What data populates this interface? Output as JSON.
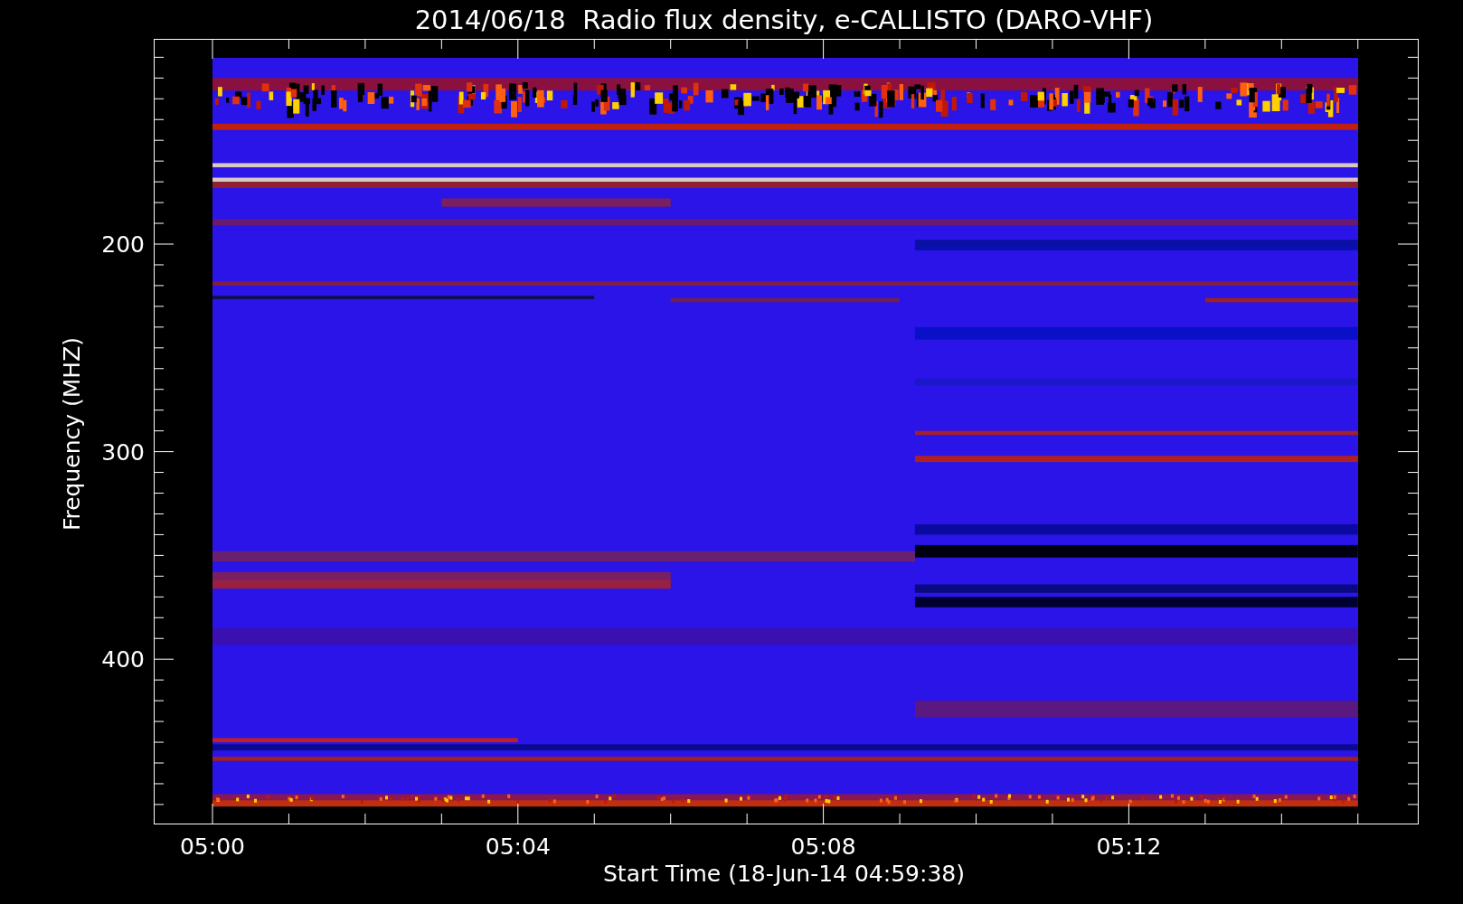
{
  "title": "2014/06/18  Radio flux density, e-CALLISTO (DARO-VHF)",
  "y_axis": {
    "label": "Frequency (MHZ)",
    "tick_labels": [
      "200",
      "300",
      "400"
    ]
  },
  "x_axis": {
    "label": "Start Time (18-Jun-14 04:59:38)",
    "tick_labels": [
      "05:00",
      "05:04",
      "05:08",
      "05:12"
    ]
  }
}
